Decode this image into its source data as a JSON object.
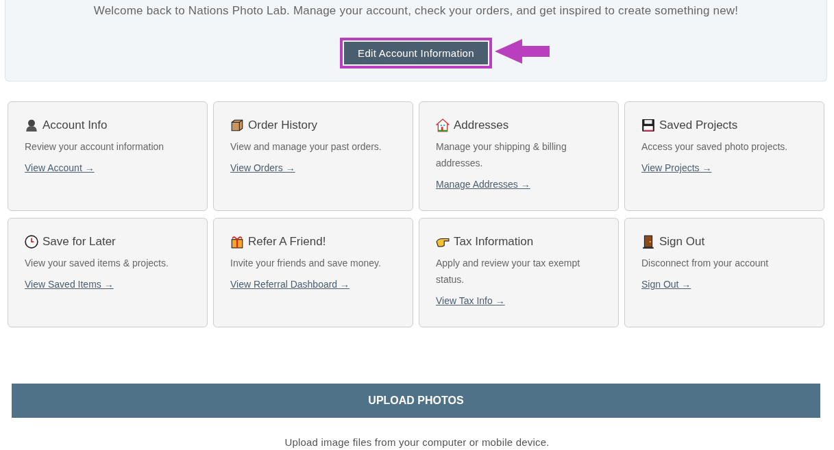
{
  "welcome": {
    "message": "Welcome back to Nations Photo Lab. Manage your account, check your orders, and get inspired to create something new!",
    "button": "Edit Account Information"
  },
  "cards": [
    {
      "title": "Account Info",
      "description": "Review your account information",
      "link": "View Account →"
    },
    {
      "title": "Order History",
      "description": "View and manage your past orders.",
      "link": "View Orders →"
    },
    {
      "title": "Addresses",
      "description": "Manage your shipping & billing addresses.",
      "link": "Manage Addresses →"
    },
    {
      "title": "Saved Projects",
      "description": "Access your saved photo projects.",
      "link": "View Projects →"
    },
    {
      "title": "Save for Later",
      "description": "View your saved items & projects.",
      "link": "View Saved Items →"
    },
    {
      "title": "Refer A Friend!",
      "description": "Invite your friends and save money.",
      "link": "View Referral Dashboard →"
    },
    {
      "title": "Tax Information",
      "description": "Apply and review your tax exempt status.",
      "link": "View Tax Info →"
    },
    {
      "title": "Sign Out",
      "description": "Disconnect from your account",
      "link": "Sign Out →"
    }
  ],
  "upload": {
    "heading": "UPLOAD PHOTOS",
    "description": "Upload image files from your computer or mobile device."
  }
}
